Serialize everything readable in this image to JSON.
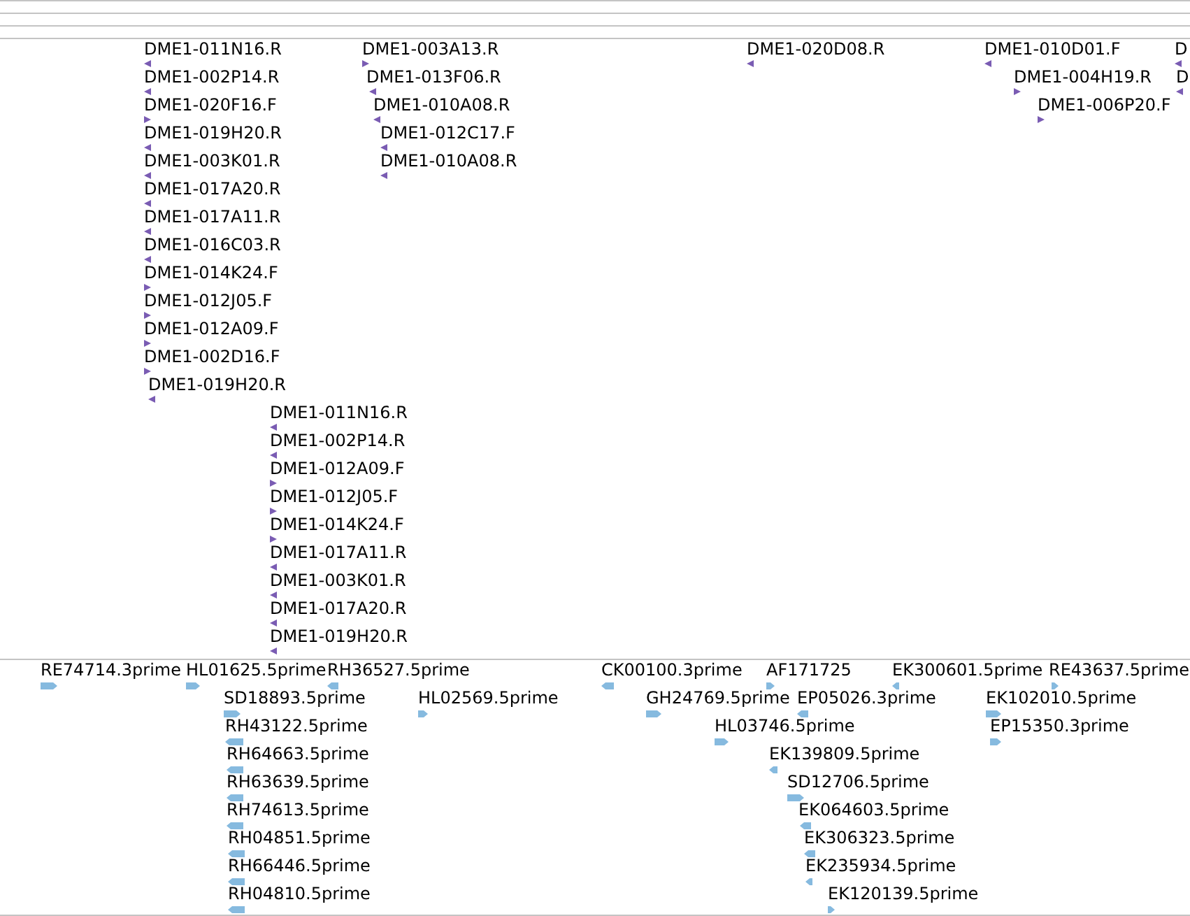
{
  "tracks": [
    {
      "kind": "triangle",
      "color": "#7a5cb3",
      "features": [
        {
          "label": "DME1-011N16.R",
          "reverse": true
        },
        {
          "label": "DME1-003A13.R",
          "reverse": false
        },
        {
          "label": "DME1-020D08.R",
          "reverse": true
        },
        {
          "label": "DME1-010D01.F",
          "reverse": true
        },
        {
          "label": "D",
          "reverse": true
        },
        {
          "label": "DME1-002P14.R",
          "reverse": true
        },
        {
          "label": "DME1-013F06.R",
          "reverse": true
        },
        {
          "label": "DME1-004H19.R",
          "reverse": false
        },
        {
          "label": "D",
          "reverse": true
        },
        {
          "label": "DME1-020F16.F",
          "reverse": false
        },
        {
          "label": "DME1-010A08.R",
          "reverse": true
        },
        {
          "label": "DME1-006P20.F",
          "reverse": false
        },
        {
          "label": "DME1-019H20.R",
          "reverse": true
        },
        {
          "label": "DME1-012C17.F",
          "reverse": true
        },
        {
          "label": "DME1-003K01.R",
          "reverse": true
        },
        {
          "label": "DME1-010A08.R",
          "reverse": true
        },
        {
          "label": "DME1-017A20.R",
          "reverse": true
        },
        {
          "label": "DME1-017A11.R",
          "reverse": true
        },
        {
          "label": "DME1-016C03.R",
          "reverse": true
        },
        {
          "label": "DME1-014K24.F",
          "reverse": false
        },
        {
          "label": "DME1-012J05.F",
          "reverse": false
        },
        {
          "label": "DME1-012A09.F",
          "reverse": false
        },
        {
          "label": "DME1-002D16.F",
          "reverse": false
        },
        {
          "label": "DME1-019H20.R",
          "reverse": true
        },
        {
          "label": "DME1-011N16.R",
          "reverse": true
        },
        {
          "label": "DME1-002P14.R",
          "reverse": true
        },
        {
          "label": "DME1-012A09.F",
          "reverse": false
        },
        {
          "label": "DME1-012J05.F",
          "reverse": false
        },
        {
          "label": "DME1-014K24.F",
          "reverse": false
        },
        {
          "label": "DME1-017A11.R",
          "reverse": true
        },
        {
          "label": "DME1-003K01.R",
          "reverse": true
        },
        {
          "label": "DME1-017A20.R",
          "reverse": true
        },
        {
          "label": "DME1-019H20.R",
          "reverse": true
        }
      ]
    },
    {
      "kind": "arrow",
      "color": "#86badf",
      "features": [
        {
          "label": "RE74714.3prime",
          "reverse": false
        },
        {
          "label": "HL01625.5prime",
          "reverse": false
        },
        {
          "label": "RH36527.5prime",
          "reverse": true
        },
        {
          "label": "CK00100.3prime",
          "reverse": true
        },
        {
          "label": "AF171725",
          "reverse": false
        },
        {
          "label": "EK300601.5prime",
          "reverse": true
        },
        {
          "label": "RE43637.5prime",
          "reverse": false
        },
        {
          "label": "SD18893.5prime",
          "reverse": false
        },
        {
          "label": "HL02569.5prime",
          "reverse": false
        },
        {
          "label": "GH24769.5prime",
          "reverse": false
        },
        {
          "label": "EP05026.3prime",
          "reverse": true
        },
        {
          "label": "EK102010.5prime",
          "reverse": false
        },
        {
          "label": "RH43122.5prime",
          "reverse": true
        },
        {
          "label": "HL03746.5prime",
          "reverse": false
        },
        {
          "label": "EP15350.3prime",
          "reverse": false
        },
        {
          "label": "RH64663.5prime",
          "reverse": true
        },
        {
          "label": "EK139809.5prime",
          "reverse": true
        },
        {
          "label": "RH63639.5prime",
          "reverse": true
        },
        {
          "label": "SD12706.5prime",
          "reverse": false
        },
        {
          "label": "RH74613.5prime",
          "reverse": true
        },
        {
          "label": "EK064603.5prime",
          "reverse": true
        },
        {
          "label": "RH04851.5prime",
          "reverse": true
        },
        {
          "label": "EK306323.5prime",
          "reverse": true
        },
        {
          "label": "RH66446.5prime",
          "reverse": true
        },
        {
          "label": "EK235934.5prime",
          "reverse": true
        },
        {
          "label": "RH04810.5prime",
          "reverse": true
        },
        {
          "label": "EK120139.5prime",
          "reverse": false
        }
      ]
    }
  ]
}
